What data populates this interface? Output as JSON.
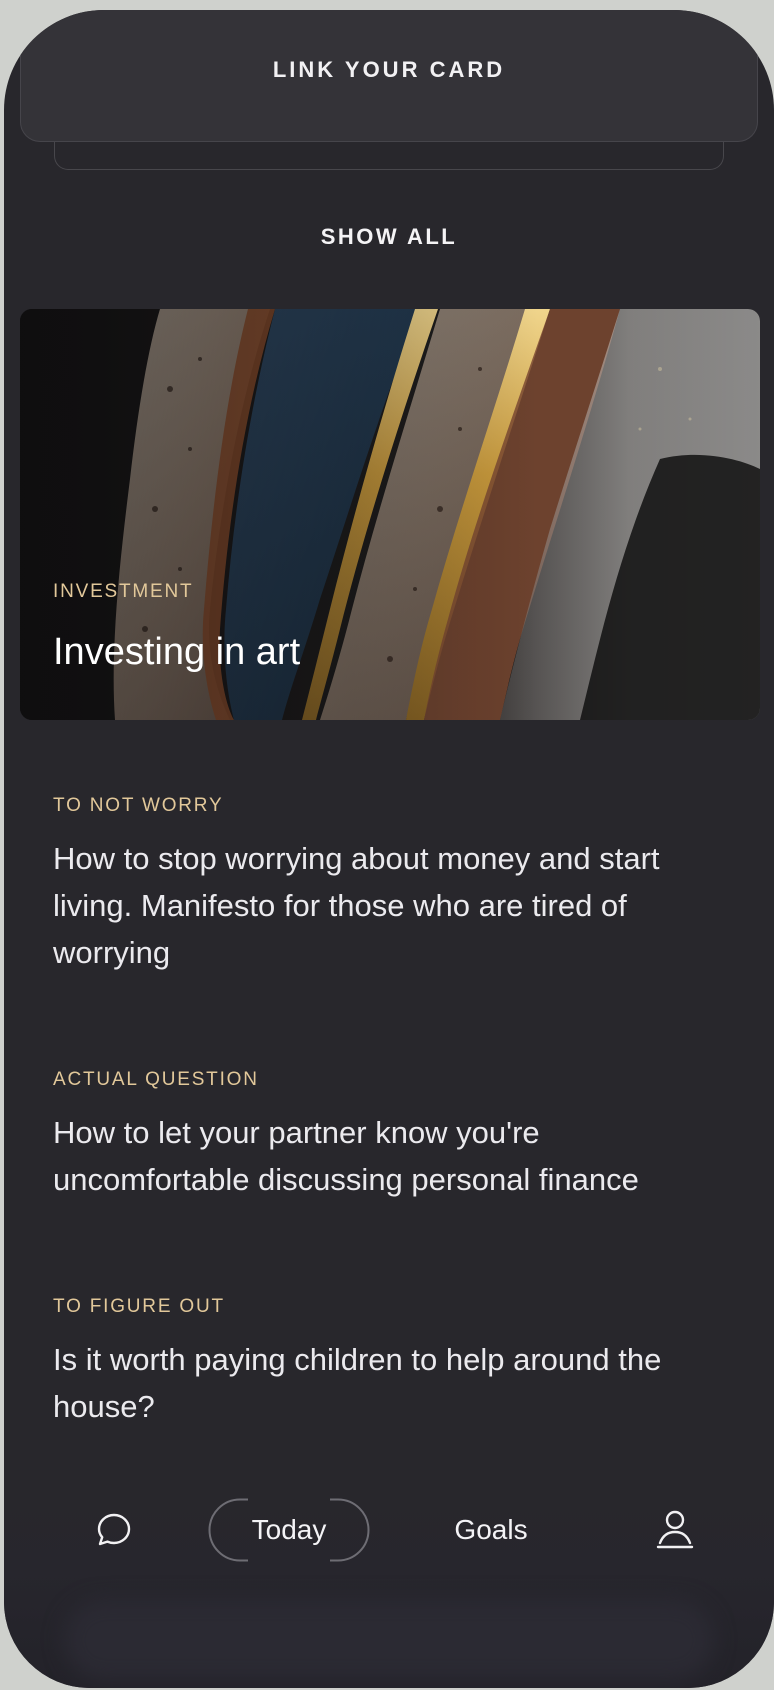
{
  "top": {
    "link_card_label": "LINK YOUR CARD",
    "show_all_label": "SHOW ALL"
  },
  "feature": {
    "tag": "INVESTMENT",
    "title": "Investing in art",
    "image": "abstract-art-ceramic-gold-streaks"
  },
  "articles": [
    {
      "tag": "TO NOT WORRY",
      "headline": "How to stop worrying about money and start living. Manifesto for those who are tired of worrying"
    },
    {
      "tag": "ACTUAL QUESTION",
      "headline": "How to let your partner know you're uncomfortable discussing personal finance"
    },
    {
      "tag": "TO FIGURE OUT",
      "headline": "Is it worth paying children to help around the house?"
    }
  ],
  "nav": {
    "chat_icon": "chat-bubble-icon",
    "today_label": "Today",
    "goals_label": "Goals",
    "profile_icon": "person-icon"
  },
  "colors": {
    "background": "#28272c",
    "accent_tag": "#e2c89a",
    "text": "#ebeaee"
  }
}
